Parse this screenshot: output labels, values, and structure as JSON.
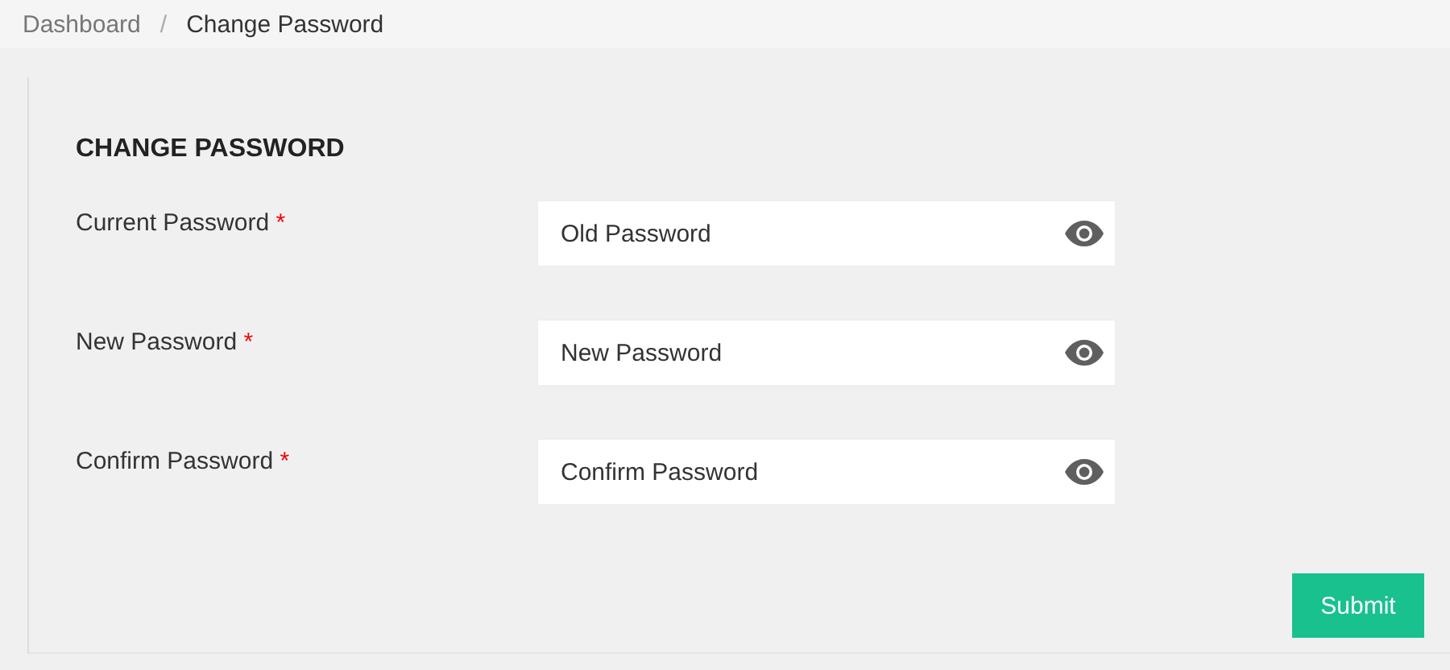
{
  "breadcrumb": [
    {
      "label": "Dashboard",
      "selected": false
    },
    {
      "label": "Change Password",
      "selected": true
    }
  ],
  "breadcrumb_separator": "/",
  "title": "CHANGE PASSWORD",
  "fields": [
    {
      "label": "Current Password",
      "required": true,
      "placeholder": "Old Password"
    },
    {
      "label": "New Password",
      "required": true,
      "placeholder": "New Password"
    },
    {
      "label": "Confirm Password",
      "required": true,
      "placeholder": "Confirm Password"
    }
  ],
  "required_mark": "*",
  "submit": "Submit"
}
